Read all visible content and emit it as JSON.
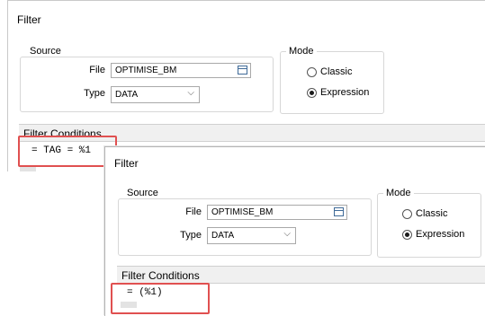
{
  "window1": {
    "title": "Filter",
    "source": {
      "legend": "Source",
      "file_label": "File",
      "file_value": "OPTIMISE_BM",
      "type_label": "Type",
      "type_value": "DATA"
    },
    "mode": {
      "legend": "Mode",
      "options": [
        {
          "label": "Classic",
          "selected": false
        },
        {
          "label": "Expression",
          "selected": true
        }
      ]
    },
    "filter_conditions": {
      "title": "Filter Conditions",
      "expression": "= TAG = %1"
    }
  },
  "window2": {
    "title": "Filter",
    "source": {
      "legend": "Source",
      "file_label": "File",
      "file_value": "OPTIMISE_BM",
      "type_label": "Type",
      "type_value": "DATA"
    },
    "mode": {
      "legend": "Mode",
      "options": [
        {
          "label": "Classic",
          "selected": false
        },
        {
          "label": "Expression",
          "selected": true
        }
      ]
    },
    "filter_conditions": {
      "title": "Filter Conditions",
      "expression": "= (%1)"
    }
  },
  "colors": {
    "highlight": "#e05050",
    "header_bg": "#f0f0f0",
    "browse_icon": "#3f6a98"
  },
  "icons": {
    "file_browse": "file-browse-icon",
    "dropdown": "chevron-down-icon"
  }
}
